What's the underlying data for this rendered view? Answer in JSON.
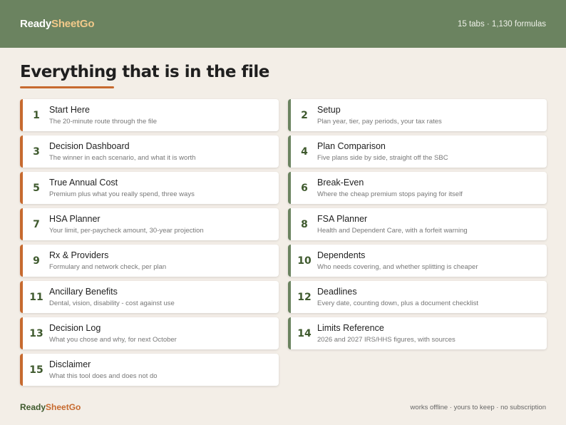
{
  "header": {
    "brand_part1": "Ready",
    "brand_part2": "SheetGo",
    "stats": "15 tabs · 1,130 formulas"
  },
  "page": {
    "title": "Everything that is in the file"
  },
  "tabs": [
    {
      "num": "1",
      "name": "Start Here",
      "desc": "The 20-minute route through the file"
    },
    {
      "num": "2",
      "name": "Setup",
      "desc": "Plan year, tier, pay periods, your tax rates"
    },
    {
      "num": "3",
      "name": "Decision Dashboard",
      "desc": "The winner in each scenario, and what it is worth"
    },
    {
      "num": "4",
      "name": "Plan Comparison",
      "desc": "Five plans side by side, straight off the SBC"
    },
    {
      "num": "5",
      "name": "True Annual Cost",
      "desc": "Premium plus what you really spend, three ways"
    },
    {
      "num": "6",
      "name": "Break-Even",
      "desc": "Where the cheap premium stops paying for itself"
    },
    {
      "num": "7",
      "name": "HSA Planner",
      "desc": "Your limit, per-paycheck amount, 30-year projection"
    },
    {
      "num": "8",
      "name": "FSA Planner",
      "desc": "Health and Dependent Care, with a forfeit warning"
    },
    {
      "num": "9",
      "name": "Rx & Providers",
      "desc": "Formulary and network check, per plan"
    },
    {
      "num": "10",
      "name": "Dependents",
      "desc": "Who needs covering, and whether splitting is cheaper"
    },
    {
      "num": "11",
      "name": "Ancillary Benefits",
      "desc": "Dental, vision, disability - cost against use"
    },
    {
      "num": "12",
      "name": "Deadlines",
      "desc": "Every date, counting down, plus a document checklist"
    },
    {
      "num": "13",
      "name": "Decision Log",
      "desc": "What you chose and why, for next October"
    },
    {
      "num": "14",
      "name": "Limits Reference",
      "desc": "2026 and 2027 IRS/HHS figures, with sources"
    },
    {
      "num": "15",
      "name": "Disclaimer",
      "desc": "What this tool does and does not do"
    }
  ],
  "footer": {
    "brand_part1": "Ready",
    "brand_part2": "SheetGo",
    "note": "works offline · yours to keep · no subscription"
  },
  "colors": {
    "header_bg": "#6b8360",
    "accent_orange": "#c76a2f",
    "accent_green": "#6b8360",
    "page_bg": "#f3eee7"
  }
}
